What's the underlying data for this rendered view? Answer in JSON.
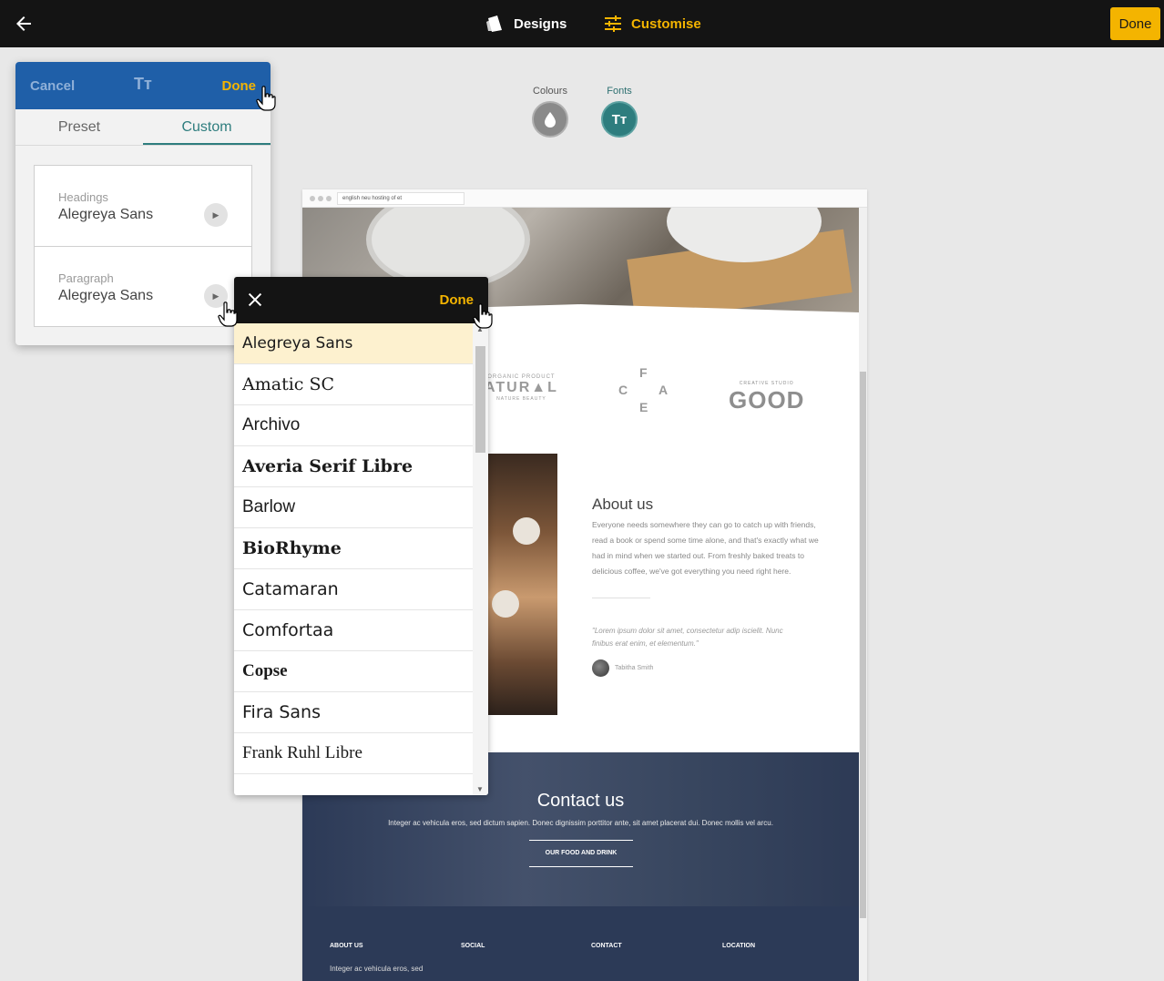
{
  "topbar": {
    "designs_label": "Designs",
    "customise_label": "Customise",
    "done_label": "Done"
  },
  "customise": {
    "colours_label": "Colours",
    "fonts_label": "Fonts",
    "fonts_icon_text": "Tт"
  },
  "font_panel": {
    "cancel_label": "Cancel",
    "header_icon_text": "Tт",
    "done_label": "Done",
    "tabs": [
      {
        "label": "Preset",
        "active": false
      },
      {
        "label": "Custom",
        "active": true
      }
    ],
    "rows": [
      {
        "label": "Headings",
        "value": "Alegreya Sans"
      },
      {
        "label": "Paragraph",
        "value": "Alegreya Sans"
      }
    ]
  },
  "font_list": {
    "done_label": "Done",
    "selected": "Alegreya Sans",
    "items": [
      {
        "name": "Alegreya Sans",
        "family": "\"DejaVu Sans\", sans-serif",
        "weight": "normal"
      },
      {
        "name": "Amatic SC",
        "family": "\"DejaVu Serif\", serif",
        "weight": "normal"
      },
      {
        "name": "Archivo",
        "family": "\"Liberation Sans\", sans-serif",
        "weight": "normal"
      },
      {
        "name": "Averia Serif Libre",
        "family": "\"DejaVu Serif\", serif",
        "weight": "bold"
      },
      {
        "name": "Barlow",
        "family": "\"Liberation Sans\", sans-serif",
        "weight": "normal"
      },
      {
        "name": "BioRhyme",
        "family": "\"DejaVu Serif\", serif",
        "weight": "bold"
      },
      {
        "name": "Catamaran",
        "family": "\"DejaVu Sans\", sans-serif",
        "weight": "normal"
      },
      {
        "name": "Comfortaa",
        "family": "\"DejaVu Sans\", sans-serif",
        "weight": "normal"
      },
      {
        "name": "Copse",
        "family": "\"Liberation Serif\", serif",
        "weight": "bold"
      },
      {
        "name": "Fira Sans",
        "family": "\"DejaVu Sans\", sans-serif",
        "weight": "normal"
      },
      {
        "name": "Frank Ruhl Libre",
        "family": "\"Liberation Serif\", serif",
        "weight": "normal"
      }
    ]
  },
  "preview": {
    "url": "english neu hosting of et",
    "logos": {
      "natural": "ATUR▲L",
      "natural_sub": "NATURE BEAUTY",
      "natural_top": "ORGANIC PRODUCT",
      "cafe_letters": [
        "F",
        "C",
        "A",
        "E"
      ],
      "good": "GOOD",
      "good_top": "CREATIVE STUDIO"
    },
    "about": {
      "title": "About us",
      "text": "Everyone needs somewhere they can go to catch up with friends, read a book or spend some time alone, and that's exactly what we had in mind when we started out. From freshly baked treats to delicious coffee, we've got everything you need right here.",
      "quote": "\"Lorem ipsum dolor sit amet, consectetur adip iscielit. Nunc finibus erat enim, et elementum.\"",
      "author": "Tabitha Smith"
    },
    "contact": {
      "title": "Contact us",
      "text": "Integer ac vehicula eros, sed dictum sapien. Donec dignissim porttitor ante, sit amet placerat dui. Donec mollis vel arcu.",
      "button": "OUR FOOD AND DRINK"
    },
    "footer": {
      "cols": [
        "ABOUT US",
        "SOCIAL",
        "CONTACT",
        "LOCATION"
      ],
      "about_text": "Integer ac vehicula eros, sed"
    }
  },
  "colors": {
    "accent": "#f4b400",
    "panel_header": "#1f5fa8",
    "teal": "#2e7d7e",
    "topbar": "#141414"
  }
}
